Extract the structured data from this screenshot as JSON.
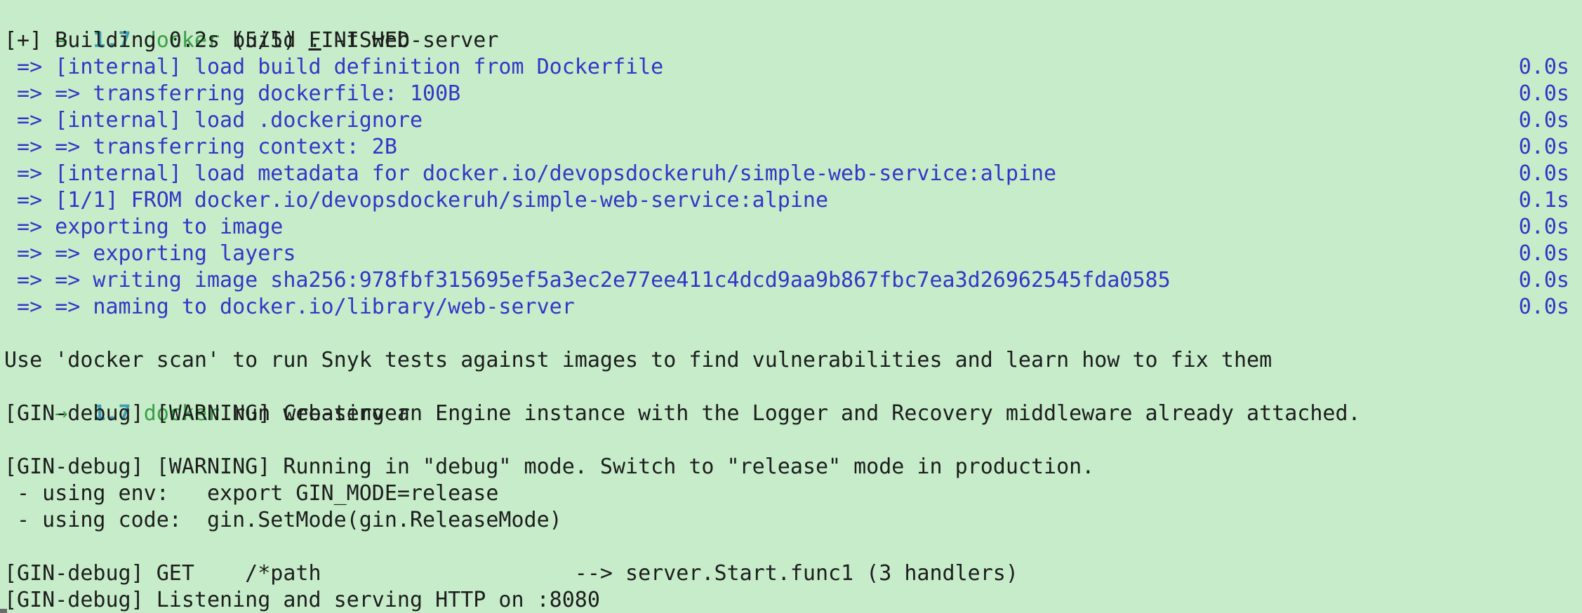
{
  "prompts": [
    {
      "arrow": "→",
      "version": "1.7",
      "command": "docker",
      "args_pre": " build ",
      "args_dot": ".",
      "args_post": " -t web-server"
    },
    {
      "arrow": "→",
      "version": "1.7",
      "command": "docker",
      "args": " run web-server"
    }
  ],
  "build_header": "[+] Building 0.2s (5/5) FINISHED",
  "build_steps": [
    {
      "text": " => [internal] load build definition from Dockerfile",
      "time": "0.0s"
    },
    {
      "text": " => => transferring dockerfile: 100B",
      "time": "0.0s"
    },
    {
      "text": " => [internal] load .dockerignore",
      "time": "0.0s"
    },
    {
      "text": " => => transferring context: 2B",
      "time": "0.0s"
    },
    {
      "text": " => [internal] load metadata for docker.io/devopsdockeruh/simple-web-service:alpine",
      "time": "0.0s"
    },
    {
      "text": " => [1/1] FROM docker.io/devopsdockeruh/simple-web-service:alpine",
      "time": "0.1s"
    },
    {
      "text": " => exporting to image",
      "time": "0.0s"
    },
    {
      "text": " => => exporting layers",
      "time": "0.0s"
    },
    {
      "text": " => => writing image sha256:978fbf315695ef5a3ec2e77ee411c4dcd9aa9b867fbc7ea3d26962545fda0585",
      "time": "0.0s"
    },
    {
      "text": " => => naming to docker.io/library/web-server",
      "time": "0.0s"
    }
  ],
  "scan_hint": "Use 'docker scan' to run Snyk tests against images to find vulnerabilities and learn how to fix them",
  "gin_output": [
    "[GIN-debug] [WARNING] Creating an Engine instance with the Logger and Recovery middleware already attached.",
    "",
    "[GIN-debug] [WARNING] Running in \"debug\" mode. Switch to \"release\" mode in production.",
    " - using env:   export GIN_MODE=release",
    " - using code:  gin.SetMode(gin.ReleaseMode)",
    "",
    "[GIN-debug] GET    /*path                    --> server.Start.func1 (3 handlers)",
    "[GIN-debug] Listening and serving HTTP on :8080"
  ],
  "colors": {
    "background": "#c6ecca",
    "prompt_green": "#3a9e45",
    "version_teal": "#3e9fb3",
    "step_blue": "#3535c6",
    "text": "#1d1d1d"
  }
}
